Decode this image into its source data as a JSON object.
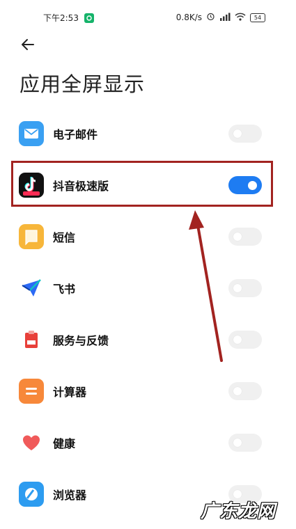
{
  "status_bar": {
    "time": "下午2:53",
    "speed": "0.8K/s",
    "battery": "54",
    "icons": [
      "wechat-icon",
      "alarm-icon",
      "signal-icon",
      "wifi-icon",
      "battery-icon"
    ]
  },
  "header": {
    "back_icon": "arrow-left-icon",
    "title": "应用全屏显示"
  },
  "apps": [
    {
      "label": "电子邮件",
      "icon": "mail-icon",
      "color": "#3aa0f2",
      "enabled": false
    },
    {
      "label": "抖音极速版",
      "icon": "douyin-icon",
      "color": "#111111",
      "enabled": true
    },
    {
      "label": "短信",
      "icon": "message-icon",
      "color": "#f7b63a",
      "enabled": false
    },
    {
      "label": "飞书",
      "icon": "feishu-icon",
      "color": "#2c6af5",
      "enabled": false
    },
    {
      "label": "服务与反馈",
      "icon": "service-feedback-icon",
      "color": "#e8403a",
      "enabled": false
    },
    {
      "label": "计算器",
      "icon": "calculator-icon",
      "color": "#f7883a",
      "enabled": false
    },
    {
      "label": "健康",
      "icon": "health-icon",
      "color": "#f05a5a",
      "enabled": false
    },
    {
      "label": "浏览器",
      "icon": "browser-icon",
      "color": "#2d9cf0",
      "enabled": false
    }
  ],
  "annotation": {
    "box_color": "#a22320",
    "arrow_color": "#a22320"
  },
  "watermark": "广东龙网"
}
